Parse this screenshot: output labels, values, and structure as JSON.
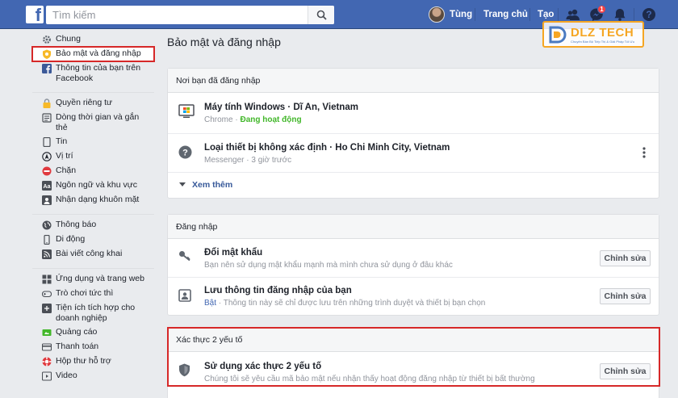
{
  "topbar": {
    "logo_letter": "f",
    "search_placeholder": "Tìm kiếm",
    "user_name": "Tùng",
    "home_label": "Trang chủ",
    "create_label": "Tạo",
    "messages_badge": "1",
    "brand_color": "#4267b2"
  },
  "watermark": {
    "text": "DLZ TECH",
    "subtext": "Chuyên Bán Bộ Tiếp Thị & Giải Pháp Tối Ưu"
  },
  "sidebar": {
    "groups": [
      [
        {
          "label": "Chung",
          "icon": "gear-icon"
        },
        {
          "label": "Bảo mật và đăng nhập",
          "icon": "shield-badge-icon",
          "active": true
        },
        {
          "label": "Thông tin của bạn trên Facebook",
          "icon": "facebook-icon"
        }
      ],
      [
        {
          "label": "Quyền riêng tư",
          "icon": "lock-icon"
        },
        {
          "label": "Dòng thời gian và gắn thẻ",
          "icon": "timeline-icon"
        },
        {
          "label": "Tin",
          "icon": "story-icon"
        },
        {
          "label": "Vị trí",
          "icon": "location-icon"
        },
        {
          "label": "Chặn",
          "icon": "block-icon"
        },
        {
          "label": "Ngôn ngữ và khu vực",
          "icon": "language-icon"
        },
        {
          "label": "Nhận dạng khuôn mặt",
          "icon": "face-recognition-icon"
        }
      ],
      [
        {
          "label": "Thông báo",
          "icon": "globe-icon"
        },
        {
          "label": "Di động",
          "icon": "mobile-icon"
        },
        {
          "label": "Bài viết công khai",
          "icon": "rss-icon"
        }
      ],
      [
        {
          "label": "Ứng dụng và trang web",
          "icon": "apps-icon"
        },
        {
          "label": "Trò chơi tức thì",
          "icon": "game-icon"
        },
        {
          "label": "Tiện ích tích hợp cho doanh nghiệp",
          "icon": "integration-icon"
        },
        {
          "label": "Quảng cáo",
          "icon": "ads-icon"
        },
        {
          "label": "Thanh toán",
          "icon": "payment-icon"
        },
        {
          "label": "Hộp thư hỗ trợ",
          "icon": "support-icon"
        },
        {
          "label": "Video",
          "icon": "video-icon"
        }
      ]
    ]
  },
  "main": {
    "title": "Bảo mật và đăng nhập",
    "where_logged_in": {
      "header": "Nơi bạn đã đăng nhập",
      "sessions": [
        {
          "title": "Máy tính Windows · Dĩ An, Vietnam",
          "app": "Chrome",
          "status": "Đang hoạt động",
          "icon": "windows-computer-icon"
        },
        {
          "title": "Loại thiết bị không xác định · Ho Chi Minh City, Vietnam",
          "app": "Messenger",
          "status": "3 giờ trước",
          "icon": "unknown-device-icon"
        }
      ],
      "see_more": "Xem thêm"
    },
    "login": {
      "header": "Đăng nhập",
      "rows": [
        {
          "title": "Đổi mật khẩu",
          "sub": "Bạn nên sử dụng mật khẩu mạnh mà mình chưa sử dụng ở đâu khác",
          "button": "Chỉnh sửa",
          "icon": "key-icon"
        },
        {
          "title": "Lưu thông tin đăng nhập của bạn",
          "sub_prefix": "Bật",
          "sub": "Thông tin này sẽ chỉ được lưu trên những trình duyệt và thiết bị bạn chọn",
          "button": "Chỉnh sửa",
          "icon": "saved-login-icon"
        }
      ]
    },
    "two_factor": {
      "header": "Xác thực 2 yếu tố",
      "rows": [
        {
          "title": "Sử dụng xác thực 2 yếu tố",
          "sub": "Chúng tôi sẽ yêu cầu mã bảo mật nếu nhận thấy hoạt động đăng nhập từ thiết bị bất thường",
          "button": "Chỉnh sửa",
          "icon": "shield-icon"
        }
      ]
    }
  },
  "colors": {
    "highlight": "#d62828",
    "active_green": "#42b72a",
    "link_blue": "#4267b2"
  }
}
